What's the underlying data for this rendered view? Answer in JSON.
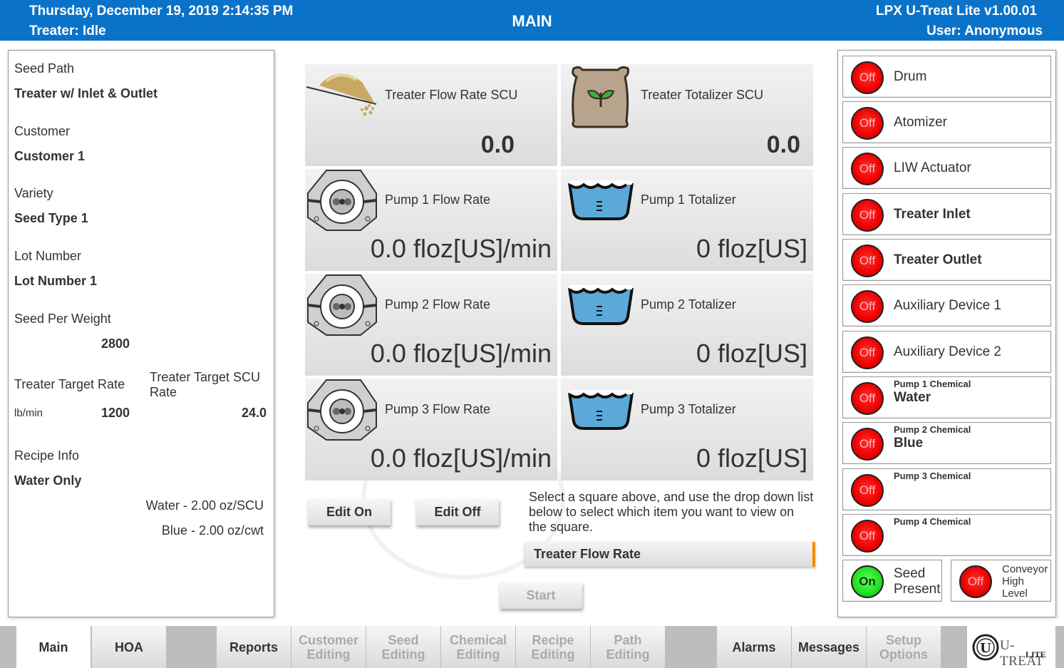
{
  "header": {
    "datetime": "Thursday, December 19, 2019 2:14:35 PM",
    "treater_status": "Treater: Idle",
    "title": "MAIN",
    "app_version": "LPX U-Treat Lite v1.00.01",
    "user": "User: Anonymous"
  },
  "left_panel": {
    "seed_path_label": "Seed Path",
    "seed_path_value": "Treater w/ Inlet & Outlet",
    "customer_label": "Customer",
    "customer_value": "Customer 1",
    "variety_label": "Variety",
    "variety_value": "Seed Type 1",
    "lot_label": "Lot Number",
    "lot_value": "Lot Number 1",
    "seed_per_weight_label": "Seed Per Weight",
    "seed_per_weight_value": "2800",
    "target_rate_label": "Treater Target Rate",
    "target_scu_label": "Treater Target SCU Rate",
    "target_rate_unit": "lb/min",
    "target_rate_value": "1200",
    "target_scu_value": "24.0",
    "recipe_label": "Recipe Info",
    "recipe_value": "Water Only",
    "recipe_line1": "Water - 2.00 oz/SCU",
    "recipe_line2": "Blue - 2.00 oz/cwt"
  },
  "tiles": {
    "t1_label": "Treater Flow Rate SCU",
    "t1_value": "0.0",
    "t2_label": "Treater Totalizer SCU",
    "t2_value": "0.0",
    "t3_label": "Pump 1 Flow Rate",
    "t3_value": "0.0 floz[US]/min",
    "t4_label": "Pump 1 Totalizer",
    "t4_value": "0 floz[US]",
    "t5_label": "Pump 2 Flow Rate",
    "t5_value": "0.0 floz[US]/min",
    "t6_label": "Pump 2 Totalizer",
    "t6_value": "0 floz[US]",
    "t7_label": "Pump 3 Flow Rate",
    "t7_value": "0.0 floz[US]/min",
    "t8_label": "Pump 3 Totalizer",
    "t8_value": "0 floz[US]"
  },
  "controls": {
    "edit_on": "Edit On",
    "edit_off": "Edit Off",
    "instructions": "Select a square above, and use the drop down list below to select which item you want to view on the square.",
    "dropdown_value": "Treater Flow Rate",
    "start": "Start"
  },
  "devices": {
    "off": "Off",
    "on": "On",
    "drum": "Drum",
    "atomizer": "Atomizer",
    "liw": "LIW Actuator",
    "inlet": "Treater Inlet",
    "outlet": "Treater Outlet",
    "aux1": "Auxiliary Device 1",
    "aux2": "Auxiliary Device 2",
    "p1_label": "Pump 1 Chemical",
    "p1_chem": "Water",
    "p2_label": "Pump 2 Chemical",
    "p2_chem": "Blue",
    "p3_label": "Pump 3 Chemical",
    "p4_label": "Pump 4 Chemical",
    "seed_present": "Seed Present",
    "conveyor": "Conveyor High Level"
  },
  "nav": {
    "main": "Main",
    "hoa": "HOA",
    "reports": "Reports",
    "customer_editing": "Customer Editing",
    "seed_editing": "Seed Editing",
    "chemical_editing": "Chemical Editing",
    "recipe_editing": "Recipe Editing",
    "path_editing": "Path Editing",
    "alarms": "Alarms",
    "messages": "Messages",
    "setup_options": "Setup Options"
  },
  "logo": {
    "text": "U-TREAT",
    "sub": "LITE"
  },
  "colors": {
    "header_blue": "#0a73c9",
    "indicator_off": "#ee0000",
    "indicator_on": "#1fe01f",
    "dropdown_accent": "#f28c00"
  }
}
